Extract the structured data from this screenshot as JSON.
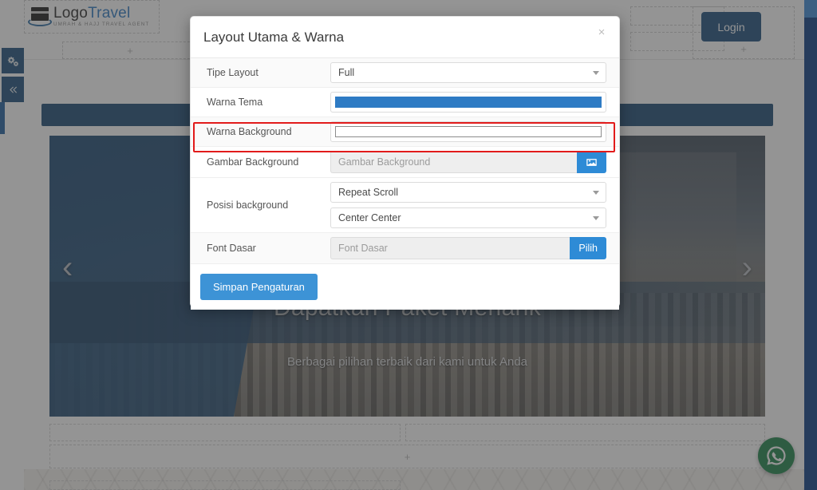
{
  "modal": {
    "title": "Layout Utama & Warna",
    "close_label": "×",
    "close_icon": "close-icon",
    "rows": {
      "tipe_layout": {
        "label": "Tipe Layout",
        "value": "Full"
      },
      "warna_tema": {
        "label": "Warna Tema",
        "color": "#2e7bc4"
      },
      "warna_background": {
        "label": "Warna Background",
        "color": "#ffffff"
      },
      "gambar_background": {
        "label": "Gambar Background",
        "placeholder": "Gambar Background",
        "value": "",
        "button_icon": "image-icon"
      },
      "posisi_background": {
        "label": "Posisi background",
        "repeat_value": "Repeat Scroll",
        "position_value": "Center Center"
      },
      "font_dasar": {
        "label": "Font Dasar",
        "placeholder": "Font Dasar",
        "value": "",
        "button_label": "Pilih"
      }
    },
    "save_button": "Simpan Pengaturan",
    "highlight_color": "#e21b1b"
  },
  "site": {
    "logo": {
      "main_part1": "Logo",
      "main_part2": "Travel",
      "tagline": "UMRAH & HAJJ TRAVEL AGENT",
      "icon": "kaaba-icon"
    },
    "login_button": "Login",
    "add_placeholder": "+",
    "hero": {
      "title": "Dapatkan Paket Menarik",
      "subtitle": "Berbagai pilihan terbaik dari kami untuk Anda",
      "prev_arrow": "‹",
      "next_arrow": "›"
    },
    "whatsapp_icon": "whatsapp-icon",
    "rail": {
      "settings_icon": "gears-icon",
      "collapse_icon": "double-chevron-left-icon",
      "collapse_glyph": "◀◀"
    },
    "colors": {
      "nav_navy": "#1b4a74",
      "accent_blue": "#2e7bc4",
      "whatsapp_green": "#1e8449"
    }
  }
}
